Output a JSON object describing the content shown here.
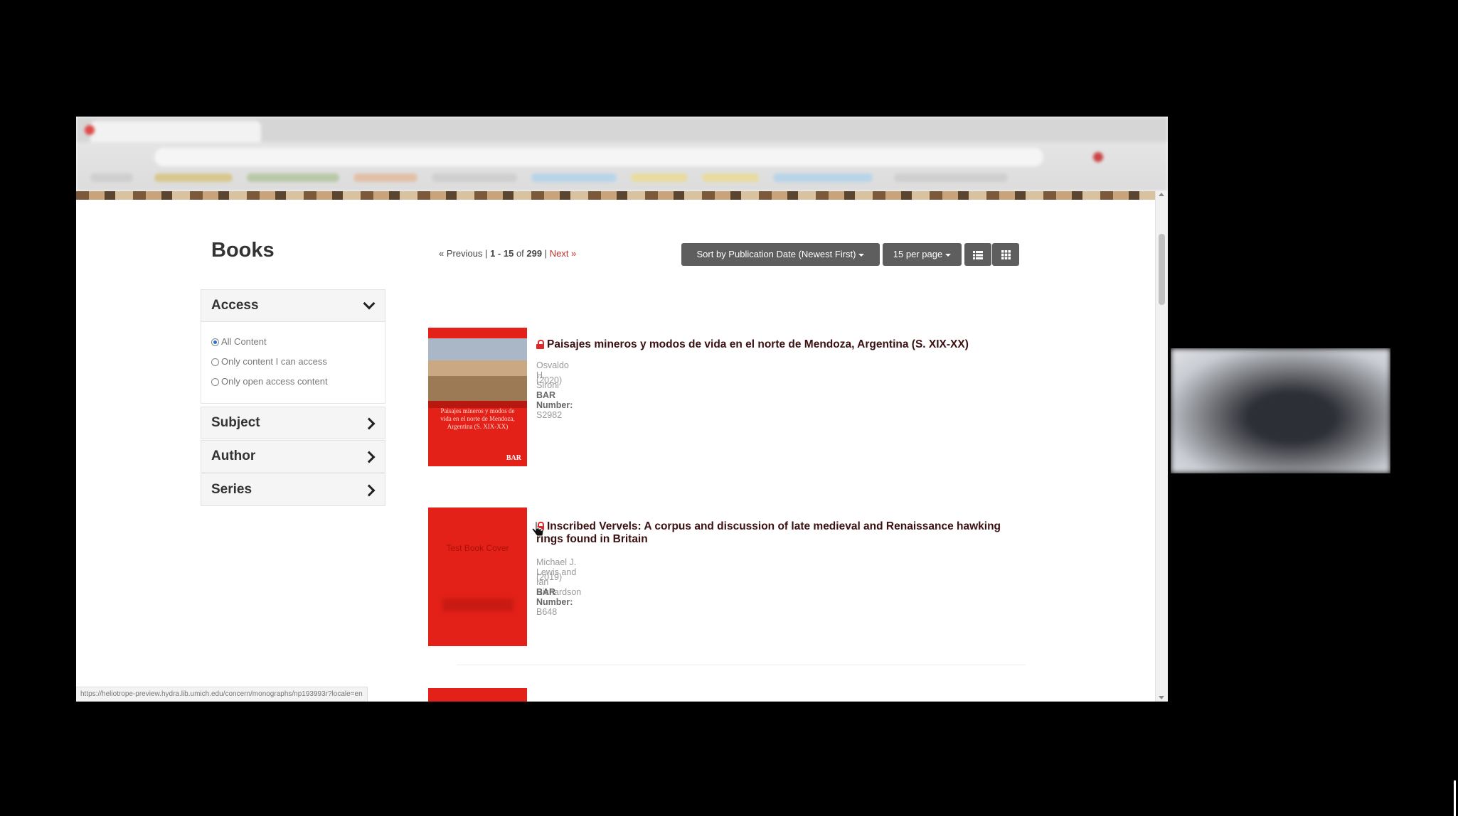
{
  "page": {
    "heading": "Books",
    "pagination": {
      "previous": "« Previous",
      "separator": "|",
      "range": "1 - 15",
      "of": "of",
      "total": "299",
      "next": "Next »"
    },
    "sort_button": "Sort by Publication Date (Newest First)",
    "per_page_button": "15 per page",
    "view_list_icon": "list-view-icon",
    "view_gallery_icon": "grid-view-icon"
  },
  "filters": {
    "access": {
      "label": "Access",
      "options": [
        "All Content",
        "Only content I can access",
        "Only open access content"
      ],
      "selected": "All Content"
    },
    "subject": {
      "label": "Subject"
    },
    "author": {
      "label": "Author"
    },
    "series": {
      "label": "Series"
    }
  },
  "results": [
    {
      "title": "Paisajes mineros y modos de vida en el norte de Mendoza, Argentina (S. XIX-XX)",
      "author": "Osvaldo H. Sironi",
      "year": "(2020)",
      "bar_label": "BAR Number:",
      "bar_number": "S2982",
      "cover_text": "Paisajes mineros y modos de vida en el norte de Mendoza, Argentina (S. XIX-XX)",
      "cover_logo": "BAR"
    },
    {
      "title": "Inscribed Vervels: A corpus and discussion of late medieval and Renaissance hawking rings found in Britain",
      "author": "Michael J. Lewis and Ian Richardson",
      "year": "(2019)",
      "bar_label": "BAR Number:",
      "bar_number": "B648",
      "cover_text": "Test Book Cover"
    }
  ],
  "status_url": "https://heliotrope-preview.hydra.lib.umich.edu/concern/monographs/np193993r?locale=en",
  "colors": {
    "accent_red": "#e32119",
    "link_red": "#c0312b",
    "button_gray": "#5e5e5e",
    "title_dark": "#3a1010"
  }
}
